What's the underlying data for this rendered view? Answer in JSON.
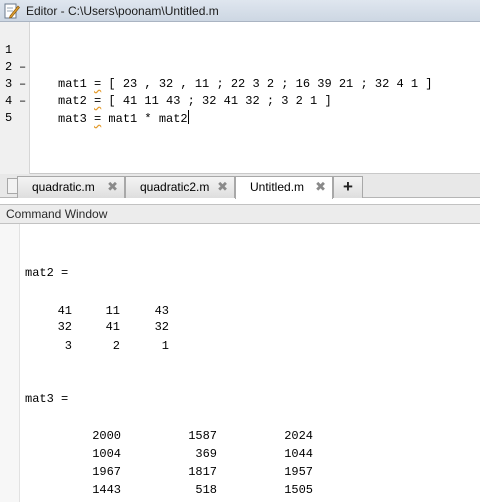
{
  "window": {
    "title": "Editor - C:\\Users\\poonam\\Untitled.m"
  },
  "editor": {
    "lines": [
      {
        "number": "1",
        "marker": "–",
        "code_pre": "mat1 ",
        "code_warn": "=",
        "code_post": " [ 23 , 32 , 11 ; 22 3 2 ; 16 39 21 ; 32 4 1 ]"
      },
      {
        "number": "2",
        "marker": "–",
        "code_pre": "mat2 ",
        "code_warn": "=",
        "code_post": " [ 41 11 43 ; 32 41 32 ; 3 2 1 ]"
      },
      {
        "number": "3",
        "marker": "–",
        "code_pre": "mat3 ",
        "code_warn": "=",
        "code_post": " mat1 * mat2"
      },
      {
        "number": "4",
        "marker": "",
        "code_pre": "",
        "code_warn": "",
        "code_post": ""
      },
      {
        "number": "5",
        "marker": "",
        "code_pre": "",
        "code_warn": "",
        "code_post": ""
      }
    ]
  },
  "tabs": [
    {
      "label": "quadratic.m",
      "close": "✖",
      "active": false
    },
    {
      "label": "quadratic2.m",
      "close": "✖",
      "active": false
    },
    {
      "label": "Untitled.m",
      "close": "✖",
      "active": true
    }
  ],
  "add_tab_label": "+",
  "command_window": {
    "title": "Command Window",
    "mat2": {
      "header": "mat2 =",
      "rows": [
        [
          "41",
          "11",
          "43"
        ],
        [
          "32",
          "41",
          "32"
        ],
        [
          "3",
          "2",
          "1"
        ]
      ]
    },
    "mat3": {
      "header": "mat3 =",
      "rows": [
        [
          "2000",
          "1587",
          "2024"
        ],
        [
          "1004",
          "369",
          "1044"
        ],
        [
          "1967",
          "1817",
          "1957"
        ],
        [
          "1443",
          "518",
          "1505"
        ]
      ]
    }
  },
  "icons": {
    "editor_icon": "pencil-document-icon",
    "close_icon": "close-x-icon",
    "add_icon": "plus-icon"
  },
  "colors": {
    "warning_underline": "#e39a2a",
    "titlebar": "#dfe6ef"
  }
}
